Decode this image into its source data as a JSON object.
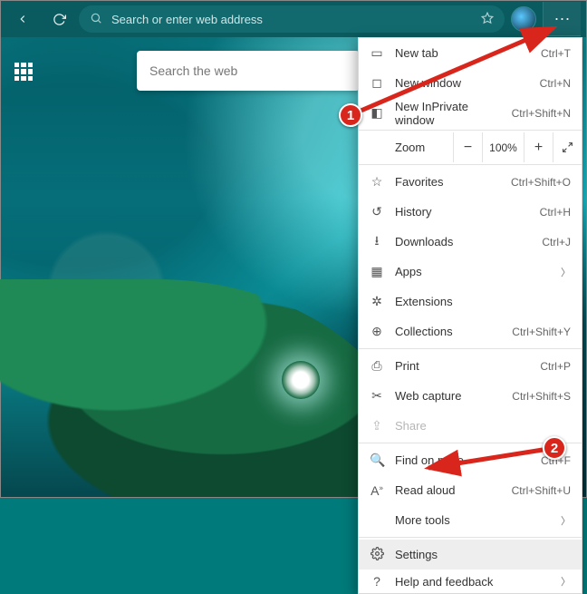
{
  "toolbar": {
    "address_placeholder": "Search or enter web address"
  },
  "page": {
    "search_placeholder": "Search the web"
  },
  "menu": {
    "new_tab": {
      "label": "New tab",
      "shortcut": "Ctrl+T"
    },
    "new_window": {
      "label": "New window",
      "shortcut": "Ctrl+N"
    },
    "new_inprivate": {
      "label": "New InPrivate window",
      "shortcut": "Ctrl+Shift+N"
    },
    "zoom": {
      "label": "Zoom",
      "value": "100%"
    },
    "favorites": {
      "label": "Favorites",
      "shortcut": "Ctrl+Shift+O"
    },
    "history": {
      "label": "History",
      "shortcut": "Ctrl+H"
    },
    "downloads": {
      "label": "Downloads",
      "shortcut": "Ctrl+J"
    },
    "apps": {
      "label": "Apps"
    },
    "extensions": {
      "label": "Extensions"
    },
    "collections": {
      "label": "Collections",
      "shortcut": "Ctrl+Shift+Y"
    },
    "print": {
      "label": "Print",
      "shortcut": "Ctrl+P"
    },
    "web_capture": {
      "label": "Web capture",
      "shortcut": "Ctrl+Shift+S"
    },
    "share": {
      "label": "Share"
    },
    "find": {
      "label": "Find on page",
      "shortcut": "Ctrl+F"
    },
    "read_aloud": {
      "label": "Read aloud",
      "shortcut": "Ctrl+Shift+U"
    },
    "more_tools": {
      "label": "More tools"
    },
    "settings": {
      "label": "Settings"
    },
    "help": {
      "label": "Help and feedback"
    }
  },
  "callouts": {
    "one": "1",
    "two": "2"
  }
}
